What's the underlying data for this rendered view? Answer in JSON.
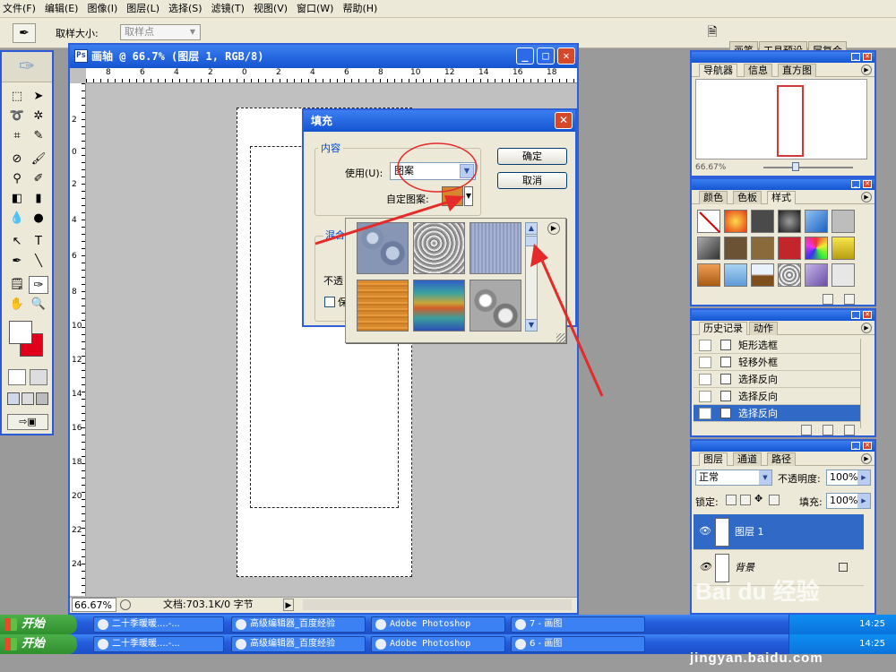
{
  "menu": [
    "文件(F)",
    "编辑(E)",
    "图像(I)",
    "图层(L)",
    "选择(S)",
    "滤镜(T)",
    "视图(V)",
    "窗口(W)",
    "帮助(H)"
  ],
  "options_bar": {
    "tool_icon": "eyedropper-icon",
    "sample_size_label": "取样大小:",
    "sample_size_value": "取样点"
  },
  "palette_well": [
    "画笔",
    "工具预设",
    "层复合"
  ],
  "document": {
    "title": "画轴 @ 66.7% (图层 1, RGB/8)",
    "zoom": "66.67%",
    "file_size": "文档:703.1K/0 字节",
    "ruler_top_labels": [
      "8",
      "6",
      "4",
      "2",
      "0",
      "2",
      "4",
      "6",
      "8",
      "10",
      "12",
      "14",
      "16",
      "18"
    ],
    "ruler_left_labels": [
      "2",
      "0",
      "2",
      "4",
      "6",
      "8",
      "10",
      "12",
      "14",
      "16",
      "18",
      "20",
      "22",
      "24"
    ]
  },
  "fill_dialog": {
    "title": "填充",
    "content_group": "内容",
    "use_label": "使用(U):",
    "use_value": "图案",
    "pattern_label": "自定图案:",
    "blend_group": "混合",
    "opacity_label": "不透",
    "preserve_label": "保",
    "ok": "确定",
    "cancel": "取消"
  },
  "navigator": {
    "tabs": [
      "导航器",
      "信息",
      "直方图"
    ],
    "zoom": "66.67%"
  },
  "swatches_palette": {
    "tabs": [
      "颜色",
      "色板",
      "样式"
    ]
  },
  "history": {
    "tabs": [
      "历史记录",
      "动作"
    ],
    "items": [
      "矩形选框",
      "轻移外框",
      "选择反向",
      "选择反向",
      "选择反向"
    ]
  },
  "layers": {
    "tabs": [
      "图层",
      "通道",
      "路径"
    ],
    "blend_mode": "正常",
    "opacity_label": "不透明度:",
    "opacity_value": "100%",
    "lock_label": "锁定:",
    "fill_label": "填充:",
    "fill_value": "100%",
    "items": [
      "图层 1",
      "背景"
    ]
  },
  "taskbar": {
    "start": "开始",
    "row1": [
      "二十季暖暖....-...",
      "高级编辑器_百度经验",
      "Adobe Photoshop",
      "7 - 画图"
    ],
    "row2": [
      "二十季暖暖....-...",
      "高级编辑器_百度经验",
      "Adobe Photoshop",
      "6 - 画图"
    ],
    "clock": "14:25"
  },
  "watermark": {
    "brand": "Bai du 经验",
    "site": "jingyan.baidu.com"
  },
  "colors": {
    "foreground": "#ffffff",
    "background": "#e0001a",
    "annotation": "#e52a2a",
    "title_bar": "#1454d2"
  }
}
